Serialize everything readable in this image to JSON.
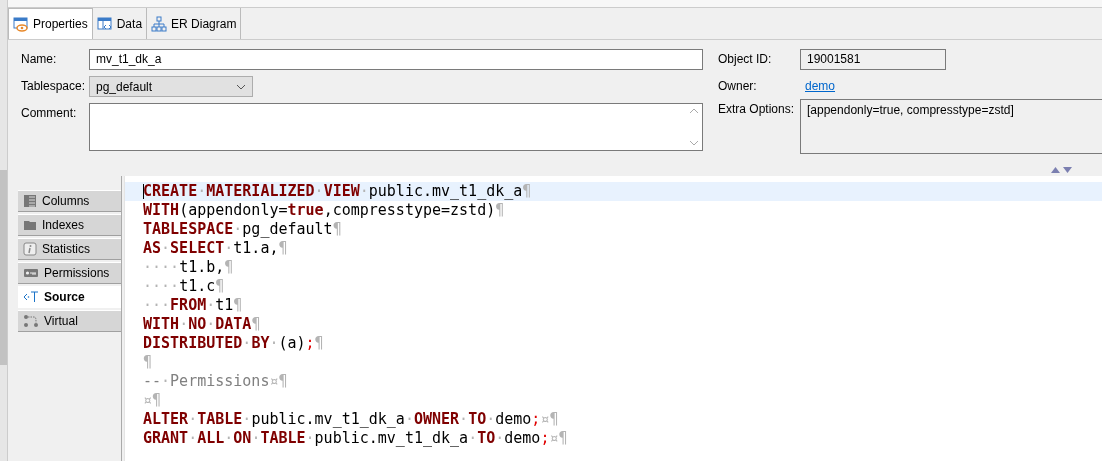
{
  "tabs": [
    {
      "label": "Properties",
      "selected": true
    },
    {
      "label": "Data",
      "selected": false
    },
    {
      "label": "ER Diagram",
      "selected": false
    }
  ],
  "form": {
    "name": {
      "label": "Name:",
      "value": "mv_t1_dk_a"
    },
    "tablespace": {
      "label": "Tablespace:",
      "value": "pg_default"
    },
    "comment": {
      "label": "Comment:"
    },
    "object_id": {
      "label": "Object ID:",
      "value": "19001581"
    },
    "owner": {
      "label": "Owner:",
      "value": "demo"
    },
    "extra_options": {
      "label": "Extra Options:",
      "value": "[appendonly=true, compresstype=zstd]"
    }
  },
  "side_tabs": [
    {
      "label": "Columns",
      "selected": false
    },
    {
      "label": "Indexes",
      "selected": false
    },
    {
      "label": "Statistics",
      "selected": false
    },
    {
      "label": "Permissions",
      "selected": false
    },
    {
      "label": "Source",
      "selected": true
    },
    {
      "label": "Virtual",
      "selected": false
    }
  ],
  "editor": {
    "lines": [
      {
        "current": true,
        "tokens": [
          {
            "kind": "kw",
            "text": "CREATE"
          },
          {
            "kind": "ws",
            "text": "·"
          },
          {
            "kind": "kw",
            "text": "MATERIALIZED"
          },
          {
            "kind": "ws",
            "text": "·"
          },
          {
            "kind": "kw",
            "text": "VIEW"
          },
          {
            "kind": "ws",
            "text": "·"
          },
          {
            "kind": "id",
            "text": "public.mv_t1_dk_a"
          },
          {
            "kind": "ws",
            "text": "¶"
          }
        ]
      },
      {
        "current": false,
        "tokens": [
          {
            "kind": "kw",
            "text": "WITH"
          },
          {
            "kind": "id",
            "text": "(appendonly="
          },
          {
            "kind": "kw",
            "text": "true"
          },
          {
            "kind": "id",
            "text": ",compresstype=zstd)"
          },
          {
            "kind": "ws",
            "text": "¶"
          }
        ]
      },
      {
        "current": false,
        "tokens": [
          {
            "kind": "kw",
            "text": "TABLESPACE"
          },
          {
            "kind": "ws",
            "text": "·"
          },
          {
            "kind": "id",
            "text": "pg_default"
          },
          {
            "kind": "ws",
            "text": "¶"
          }
        ]
      },
      {
        "current": false,
        "tokens": [
          {
            "kind": "kw",
            "text": "AS"
          },
          {
            "kind": "ws",
            "text": "·"
          },
          {
            "kind": "kw",
            "text": "SELECT"
          },
          {
            "kind": "ws",
            "text": "·"
          },
          {
            "kind": "id",
            "text": "t1.a,"
          },
          {
            "kind": "ws",
            "text": "¶"
          }
        ]
      },
      {
        "current": false,
        "tokens": [
          {
            "kind": "ws",
            "text": "····"
          },
          {
            "kind": "id",
            "text": "t1.b,"
          },
          {
            "kind": "ws",
            "text": "¶"
          }
        ]
      },
      {
        "current": false,
        "tokens": [
          {
            "kind": "ws",
            "text": "····"
          },
          {
            "kind": "id",
            "text": "t1.c"
          },
          {
            "kind": "ws",
            "text": "¶"
          }
        ]
      },
      {
        "current": false,
        "tokens": [
          {
            "kind": "ws",
            "text": "···"
          },
          {
            "kind": "kw",
            "text": "FROM"
          },
          {
            "kind": "ws",
            "text": "·"
          },
          {
            "kind": "id",
            "text": "t1"
          },
          {
            "kind": "ws",
            "text": "¶"
          }
        ]
      },
      {
        "current": false,
        "tokens": [
          {
            "kind": "kw",
            "text": "WITH"
          },
          {
            "kind": "ws",
            "text": "·"
          },
          {
            "kind": "kw",
            "text": "NO"
          },
          {
            "kind": "ws",
            "text": "·"
          },
          {
            "kind": "kw",
            "text": "DATA"
          },
          {
            "kind": "ws",
            "text": "¶"
          }
        ]
      },
      {
        "current": false,
        "tokens": [
          {
            "kind": "kw",
            "text": "DISTRIBUTED"
          },
          {
            "kind": "ws",
            "text": "·"
          },
          {
            "kind": "kw",
            "text": "BY"
          },
          {
            "kind": "ws",
            "text": "·"
          },
          {
            "kind": "id",
            "text": "(a)"
          },
          {
            "kind": "pun",
            "text": ";"
          },
          {
            "kind": "ws",
            "text": "¶"
          }
        ]
      },
      {
        "current": false,
        "tokens": [
          {
            "kind": "ws",
            "text": "¶"
          }
        ]
      },
      {
        "current": false,
        "tokens": [
          {
            "kind": "cm",
            "text": "--"
          },
          {
            "kind": "ws",
            "text": "·"
          },
          {
            "kind": "cm",
            "text": "Permissions"
          },
          {
            "kind": "ws",
            "text": "¤¶"
          }
        ]
      },
      {
        "current": false,
        "tokens": [
          {
            "kind": "ws",
            "text": "¤¶"
          }
        ]
      },
      {
        "current": false,
        "tokens": [
          {
            "kind": "kw",
            "text": "ALTER"
          },
          {
            "kind": "ws",
            "text": "·"
          },
          {
            "kind": "kw",
            "text": "TABLE"
          },
          {
            "kind": "ws",
            "text": "·"
          },
          {
            "kind": "id",
            "text": "public.mv_t1_dk_a"
          },
          {
            "kind": "ws",
            "text": "·"
          },
          {
            "kind": "kw",
            "text": "OWNER"
          },
          {
            "kind": "ws",
            "text": "·"
          },
          {
            "kind": "kw",
            "text": "TO"
          },
          {
            "kind": "ws",
            "text": "·"
          },
          {
            "kind": "id",
            "text": "demo"
          },
          {
            "kind": "pun",
            "text": ";"
          },
          {
            "kind": "ws",
            "text": "¤¶"
          }
        ]
      },
      {
        "current": false,
        "tokens": [
          {
            "kind": "kw",
            "text": "GRANT"
          },
          {
            "kind": "ws",
            "text": "·"
          },
          {
            "kind": "kw",
            "text": "ALL"
          },
          {
            "kind": "ws",
            "text": "·"
          },
          {
            "kind": "kw",
            "text": "ON"
          },
          {
            "kind": "ws",
            "text": "·"
          },
          {
            "kind": "kw",
            "text": "TABLE"
          },
          {
            "kind": "ws",
            "text": "·"
          },
          {
            "kind": "id",
            "text": "public.mv_t1_dk_a"
          },
          {
            "kind": "ws",
            "text": "·"
          },
          {
            "kind": "kw",
            "text": "TO"
          },
          {
            "kind": "ws",
            "text": "·"
          },
          {
            "kind": "id",
            "text": "demo"
          },
          {
            "kind": "pun",
            "text": ";"
          },
          {
            "kind": "ws",
            "text": "¤¶"
          }
        ]
      }
    ]
  }
}
